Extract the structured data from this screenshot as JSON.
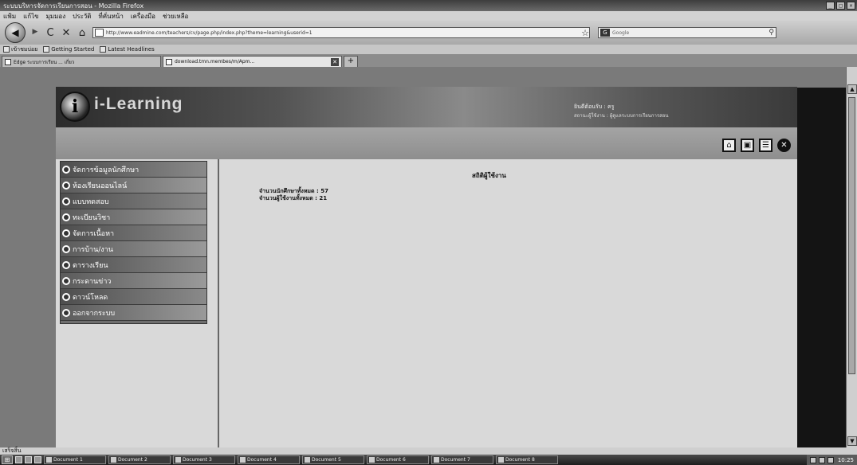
{
  "window": {
    "title": "ระบบบริหารจัดการเรียนการสอน - Mozilla Firefox",
    "minimize": "_",
    "maximize": "□",
    "close": "✕"
  },
  "menu": [
    "แฟ้ม",
    "แก้ไข",
    "มุมมอง",
    "ประวัติ",
    "ที่คั่นหน้า",
    "เครื่องมือ",
    "ช่วยเหลือ"
  ],
  "nav": {
    "back": "◀",
    "forward": "▶",
    "reload": "C",
    "stop": "✕",
    "home": "⌂",
    "url": "http://www.eadmine.com/teachers/cv/page.php/index.php?theme=learning&userid=1",
    "search_engine": "G",
    "search_placeholder": "Google"
  },
  "bookmarks": [
    "เข้าชมบ่อย",
    "Getting Started",
    "Latest Headlines"
  ],
  "tabs": [
    {
      "label": "Edge ระบบการเรียน ... เกี่ยว"
    },
    {
      "label": "download.tmn.membes/m/Apm..."
    }
  ],
  "site": {
    "logo_letter": "i",
    "logo_text": "i-Learning",
    "header_user": "ยินดีต้อนรับ : ครู",
    "header_status": "สถานะผู้ใช้งาน : ผู้ดูแลระบบการเรียนการสอน",
    "tool_icons": [
      {
        "name": "home-icon",
        "glyph": "⌂"
      },
      {
        "name": "save-icon",
        "glyph": "▣"
      },
      {
        "name": "user-icon",
        "glyph": "☰"
      },
      {
        "name": "logout-icon",
        "glyph": "✕"
      }
    ]
  },
  "sidemenu": [
    "จัดการข้อมูลนักศึกษา",
    "ห้องเรียนออนไลน์",
    "แบบทดสอบ",
    "ทะเบียนวิชา",
    "จัดการเนื้อหา",
    "การบ้าน/งาน",
    "ตารางเรียน",
    "กระดานข่าว",
    "ดาวน์โหลด",
    "ออกจากระบบ"
  ],
  "content": {
    "title": "สถิติผู้ใช้งาน",
    "stat_1": "จำนวนนักศึกษาทั้งหมด : 57",
    "stat_2": "จำนวนผู้ใช้งานทั้งหมด : 21"
  },
  "statusbar": {
    "text": "เสร็จสิ้น"
  },
  "taskbar": {
    "start": "⊞",
    "items": [
      "Document 1",
      "Document 2",
      "Document 3",
      "Document 4",
      "Document 5",
      "Document 6",
      "Document 7",
      "Document 8"
    ],
    "clock": "10:25"
  },
  "colors": {
    "content_bg": "#d9d9d9",
    "menu_bg": "#6e6e6e",
    "header_dark": "#2c2c2c"
  }
}
